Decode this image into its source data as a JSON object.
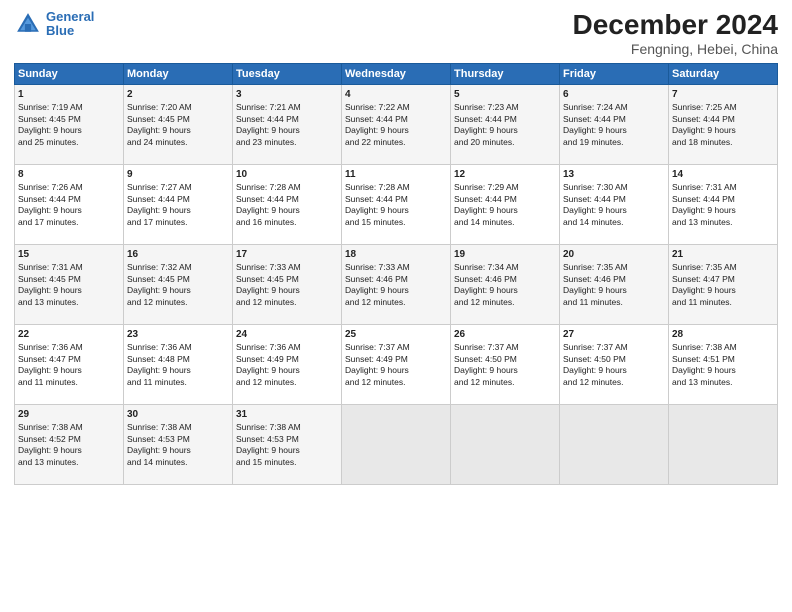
{
  "header": {
    "logo_line1": "General",
    "logo_line2": "Blue",
    "title": "December 2024",
    "subtitle": "Fengning, Hebei, China"
  },
  "days_of_week": [
    "Sunday",
    "Monday",
    "Tuesday",
    "Wednesday",
    "Thursday",
    "Friday",
    "Saturday"
  ],
  "weeks": [
    [
      {
        "day": "1",
        "info": "Sunrise: 7:19 AM\nSunset: 4:45 PM\nDaylight: 9 hours\nand 25 minutes."
      },
      {
        "day": "2",
        "info": "Sunrise: 7:20 AM\nSunset: 4:45 PM\nDaylight: 9 hours\nand 24 minutes."
      },
      {
        "day": "3",
        "info": "Sunrise: 7:21 AM\nSunset: 4:44 PM\nDaylight: 9 hours\nand 23 minutes."
      },
      {
        "day": "4",
        "info": "Sunrise: 7:22 AM\nSunset: 4:44 PM\nDaylight: 9 hours\nand 22 minutes."
      },
      {
        "day": "5",
        "info": "Sunrise: 7:23 AM\nSunset: 4:44 PM\nDaylight: 9 hours\nand 20 minutes."
      },
      {
        "day": "6",
        "info": "Sunrise: 7:24 AM\nSunset: 4:44 PM\nDaylight: 9 hours\nand 19 minutes."
      },
      {
        "day": "7",
        "info": "Sunrise: 7:25 AM\nSunset: 4:44 PM\nDaylight: 9 hours\nand 18 minutes."
      }
    ],
    [
      {
        "day": "8",
        "info": "Sunrise: 7:26 AM\nSunset: 4:44 PM\nDaylight: 9 hours\nand 17 minutes."
      },
      {
        "day": "9",
        "info": "Sunrise: 7:27 AM\nSunset: 4:44 PM\nDaylight: 9 hours\nand 17 minutes."
      },
      {
        "day": "10",
        "info": "Sunrise: 7:28 AM\nSunset: 4:44 PM\nDaylight: 9 hours\nand 16 minutes."
      },
      {
        "day": "11",
        "info": "Sunrise: 7:28 AM\nSunset: 4:44 PM\nDaylight: 9 hours\nand 15 minutes."
      },
      {
        "day": "12",
        "info": "Sunrise: 7:29 AM\nSunset: 4:44 PM\nDaylight: 9 hours\nand 14 minutes."
      },
      {
        "day": "13",
        "info": "Sunrise: 7:30 AM\nSunset: 4:44 PM\nDaylight: 9 hours\nand 14 minutes."
      },
      {
        "day": "14",
        "info": "Sunrise: 7:31 AM\nSunset: 4:44 PM\nDaylight: 9 hours\nand 13 minutes."
      }
    ],
    [
      {
        "day": "15",
        "info": "Sunrise: 7:31 AM\nSunset: 4:45 PM\nDaylight: 9 hours\nand 13 minutes."
      },
      {
        "day": "16",
        "info": "Sunrise: 7:32 AM\nSunset: 4:45 PM\nDaylight: 9 hours\nand 12 minutes."
      },
      {
        "day": "17",
        "info": "Sunrise: 7:33 AM\nSunset: 4:45 PM\nDaylight: 9 hours\nand 12 minutes."
      },
      {
        "day": "18",
        "info": "Sunrise: 7:33 AM\nSunset: 4:46 PM\nDaylight: 9 hours\nand 12 minutes."
      },
      {
        "day": "19",
        "info": "Sunrise: 7:34 AM\nSunset: 4:46 PM\nDaylight: 9 hours\nand 12 minutes."
      },
      {
        "day": "20",
        "info": "Sunrise: 7:35 AM\nSunset: 4:46 PM\nDaylight: 9 hours\nand 11 minutes."
      },
      {
        "day": "21",
        "info": "Sunrise: 7:35 AM\nSunset: 4:47 PM\nDaylight: 9 hours\nand 11 minutes."
      }
    ],
    [
      {
        "day": "22",
        "info": "Sunrise: 7:36 AM\nSunset: 4:47 PM\nDaylight: 9 hours\nand 11 minutes."
      },
      {
        "day": "23",
        "info": "Sunrise: 7:36 AM\nSunset: 4:48 PM\nDaylight: 9 hours\nand 11 minutes."
      },
      {
        "day": "24",
        "info": "Sunrise: 7:36 AM\nSunset: 4:49 PM\nDaylight: 9 hours\nand 12 minutes."
      },
      {
        "day": "25",
        "info": "Sunrise: 7:37 AM\nSunset: 4:49 PM\nDaylight: 9 hours\nand 12 minutes."
      },
      {
        "day": "26",
        "info": "Sunrise: 7:37 AM\nSunset: 4:50 PM\nDaylight: 9 hours\nand 12 minutes."
      },
      {
        "day": "27",
        "info": "Sunrise: 7:37 AM\nSunset: 4:50 PM\nDaylight: 9 hours\nand 12 minutes."
      },
      {
        "day": "28",
        "info": "Sunrise: 7:38 AM\nSunset: 4:51 PM\nDaylight: 9 hours\nand 13 minutes."
      }
    ],
    [
      {
        "day": "29",
        "info": "Sunrise: 7:38 AM\nSunset: 4:52 PM\nDaylight: 9 hours\nand 13 minutes."
      },
      {
        "day": "30",
        "info": "Sunrise: 7:38 AM\nSunset: 4:53 PM\nDaylight: 9 hours\nand 14 minutes."
      },
      {
        "day": "31",
        "info": "Sunrise: 7:38 AM\nSunset: 4:53 PM\nDaylight: 9 hours\nand 15 minutes."
      },
      {
        "day": "",
        "info": ""
      },
      {
        "day": "",
        "info": ""
      },
      {
        "day": "",
        "info": ""
      },
      {
        "day": "",
        "info": ""
      }
    ]
  ]
}
